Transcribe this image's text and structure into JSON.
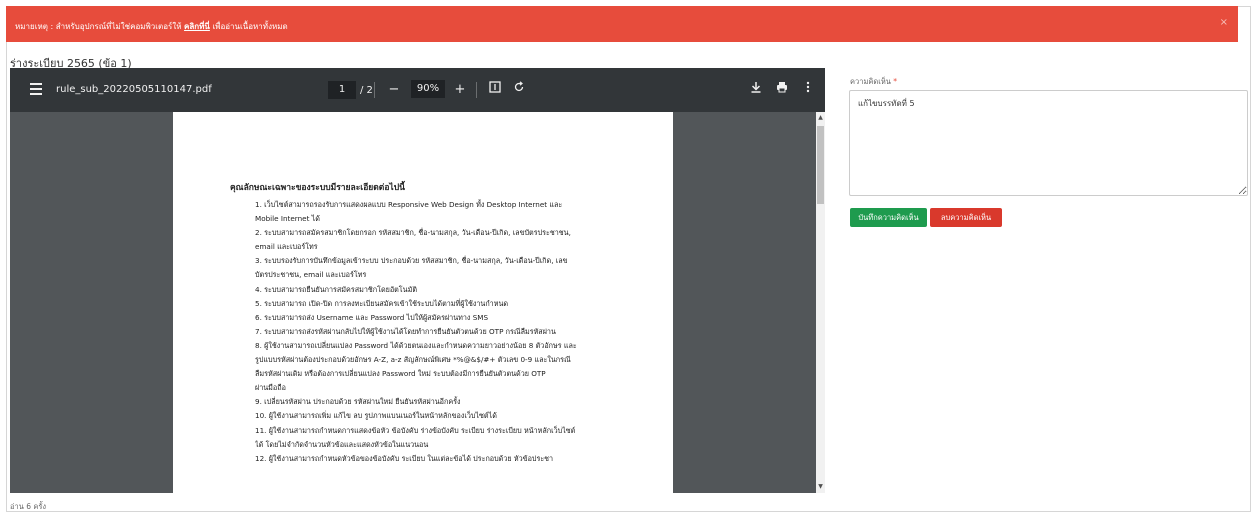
{
  "alert": {
    "message_prefix": "หมายเหตุ : สำหรับอุปกรณ์ที่ไม่ใช่คอมพิวเตอร์ให้",
    "link_text": "คลิกที่นี่",
    "message_suffix": "เพื่ออ่านเนื้อหาทั้งหมด",
    "close": "×",
    "color": "#e74c3c"
  },
  "document_title": "ร่างระเบียบ 2565 (ข้อ 1)",
  "viewer": {
    "filename": "rule_sub_20220505110147.pdf",
    "current_page": "1",
    "total_pages": "/ 2",
    "zoom": "90%",
    "icons": {
      "menu": "menu-icon",
      "zoom_out": "minus-icon",
      "zoom_in": "plus-icon",
      "fit": "fit-page-icon",
      "rotate": "rotate-icon",
      "download": "download-icon",
      "print": "print-icon",
      "more": "more-vert-icon"
    }
  },
  "pdf": {
    "heading": "คุณลักษณะเฉพาะของระบบมีรายละเอียดต่อไปนี้",
    "lines": [
      "1. เว็บไซต์สามารถรองรับการแสดงผลแบบ Responsive Web Design ทั้ง Desktop Internet และ",
      "Mobile Internet ได้",
      "2. ระบบสามารถสมัครสมาชิกโดยกรอก รหัสสมาชิก, ชื่อ-นามสกุล, วัน-เดือน-ปีเกิด, เลขบัตรประชาชน,",
      "email และเบอร์โทร",
      "3. ระบบรองรับการบันทึกข้อมูลเข้าระบบ ประกอบด้วย รหัสสมาชิก, ชื่อ-นามสกุล, วัน-เดือน-ปีเกิด, เลข",
      "บัตรประชาชน, email และเบอร์โทร",
      "4. ระบบสามารถยืนยันการสมัครสมาชิกโดยอัตโนมัติ",
      "5. ระบบสามารถ เปิด-ปิด การลงทะเบียนสมัครเข้าใช้ระบบได้ตามที่ผู้ใช้งานกำหนด",
      "6. ระบบสามารถส่ง Username และ Password ไปให้ผู้สมัครผ่านทาง SMS",
      "7. ระบบสามารถส่งรหัสผ่านกลับไปให้ผู้ใช้งานได้โดยทำการยืนยันตัวตนด้วย OTP กรณีลืมรหัสผ่าน",
      "8. ผู้ใช้งานสามารถเปลี่ยนแปลง Password ได้ด้วยตนเองและกำหนดความยาวอย่างน้อย 8 ตัวอักษร และ",
      "รูปแบบรหัสผ่านต้องประกอบด้วยอักษร A-Z, a-z สัญลักษณ์พิเศษ *%@&$/#+ ตัวเลข 0-9 และในกรณี",
      "ลืมรหัสผ่านเดิม หรือต้องการเปลี่ยนแปลง Password ใหม่ ระบบต้องมีการยืนยันตัวตนด้วย OTP",
      "ผ่านมือถือ",
      "9. เปลี่ยนรหัสผ่าน ประกอบด้วย รหัสผ่านใหม่  ยืนยันรหัสผ่านอีกครั้ง",
      "10. ผู้ใช้งานสามารถเพิ่ม แก้ไข ลบ รูปภาพแบนเนอร์ในหน้าหลักของเว็บไซต์ได้",
      "11. ผู้ใช้งานสามารถกำหนดการแสดงข้อหัว ข้อบังคับ ร่างข้อบังคับ ระเบียบ ร่างระเบียบ หน้าหลักเว็บไซต์",
      "ได้ โดยไม่จำกัดจำนวนหัวข้อและแสดงหัวข้อในแนวนอน",
      "12. ผู้ใช้งานสามารถกำหนดหัวข้อของข้อบังคับ ระเบียบ ในแต่ละข้อได้ ประกอบด้วย หัวข้อประชา"
    ]
  },
  "read_count": "อ่าน 6 ครั้ง",
  "comment": {
    "label": "ความคิดเห็น",
    "required_mark": "*",
    "value": "แก้ไขบรรทัดที่ 5",
    "save_label": "บันทึกความคิดเห็น",
    "delete_label": "ลบความคิดเห็น",
    "save_color": "#1e9b4e",
    "delete_color": "#d9392c"
  }
}
